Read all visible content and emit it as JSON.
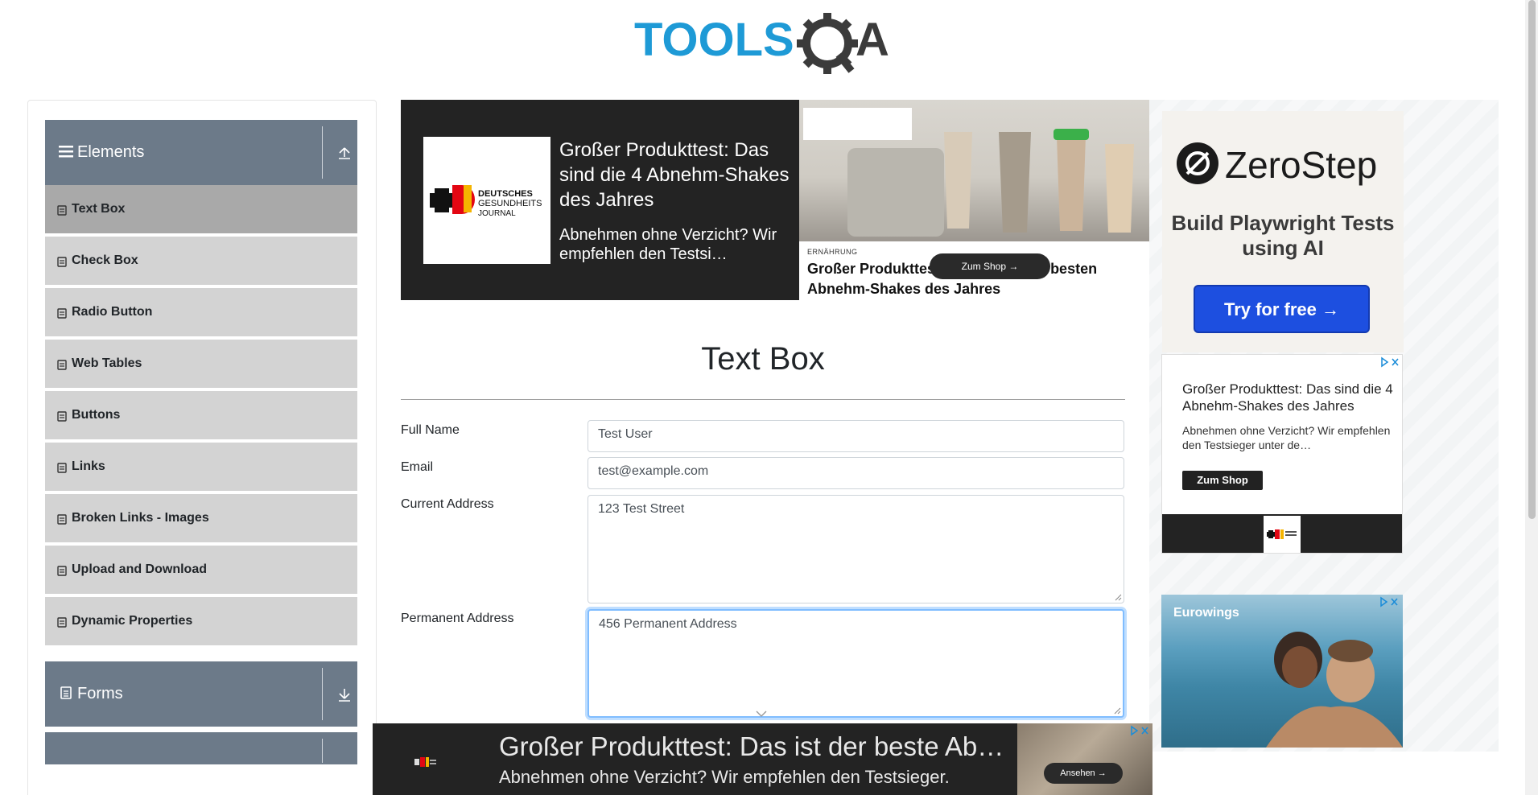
{
  "site": {
    "logo_text": "TOOLSQA"
  },
  "sidebar": {
    "groups": [
      {
        "title": "Elements"
      },
      {
        "title": "Forms"
      }
    ],
    "items": [
      {
        "label": "Text Box"
      },
      {
        "label": "Check Box"
      },
      {
        "label": "Radio Button"
      },
      {
        "label": "Web Tables"
      },
      {
        "label": "Buttons"
      },
      {
        "label": "Links"
      },
      {
        "label": "Broken Links - Images"
      },
      {
        "label": "Upload and Download"
      },
      {
        "label": "Dynamic Properties"
      }
    ]
  },
  "main": {
    "title": "Text Box",
    "fields": {
      "full_name": {
        "label": "Full Name",
        "value": "Test User"
      },
      "email": {
        "label": "Email",
        "value": "test@example.com"
      },
      "current_address": {
        "label": "Current Address",
        "value": "123 Test Street"
      },
      "permanent_address": {
        "label": "Permanent Address",
        "value": "456 Permanent Address"
      }
    }
  },
  "ads": {
    "top": {
      "logo_line1": "DEUTSCHES",
      "logo_line2": "GESUNDHEITS",
      "logo_line3": "JOURNAL",
      "headline": "Großer Produkttest: Das sind die 4 Abnehm-Shakes des Jahres",
      "text": "Abnehmen ohne Verzicht? Wir empfehlen den Testsi…",
      "category": "ERNÄHRUNG",
      "caption": "Großer Produkttest: Das sind die 4 besten Abnehm-Shakes des Jahres",
      "shop_button": "Zum Shop →"
    },
    "zerostep": {
      "name": "ZeroStep",
      "tagline": "Build Playwright Tests using AI",
      "button": "Try for free →"
    },
    "card": {
      "headline": "Großer Produkttest: Das sind die 4 Abnehm-Shakes des Jahres",
      "text": "Abnehmen ohne Verzicht? Wir empfehlen den Testsieger unter de…",
      "button": "Zum Shop"
    },
    "travel": {
      "brand": "Eurowings"
    },
    "bottom": {
      "headline": "Großer Produkttest: Das ist der beste Abn…",
      "text": "Abnehmen ohne Verzicht? Wir empfehlen den Testsieger.",
      "shop_button": "Ansehen →"
    }
  },
  "colors": {
    "logo_blue": "#1e9ad6",
    "logo_gray": "#3b3b3b",
    "group_header": "#6c7a89",
    "menu_item": "#d3d3d3",
    "menu_item_active": "#a9a9a9",
    "focus_border": "#80bdff",
    "zerostep_button": "#1d4fe0"
  }
}
